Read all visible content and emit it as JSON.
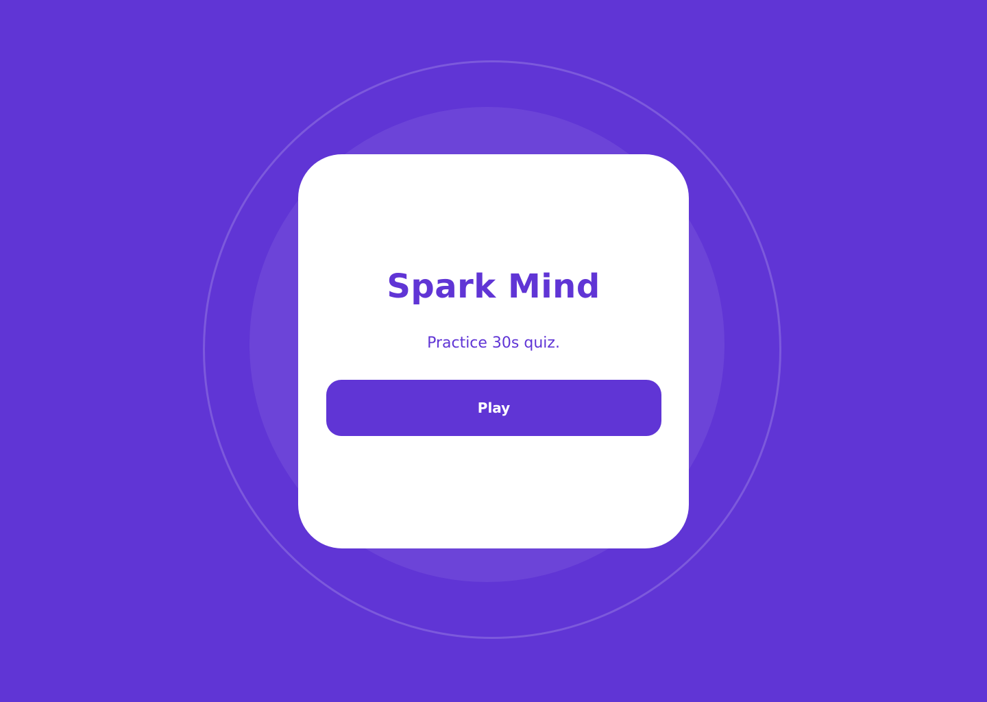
{
  "app": {
    "title": "Spark Mind",
    "subtitle": "Practice 30s quiz.",
    "play_label": "Play"
  },
  "colors": {
    "background": "#6035d5",
    "card": "#ffffff",
    "accent": "#6035d5",
    "button_text": "#ffffff"
  }
}
